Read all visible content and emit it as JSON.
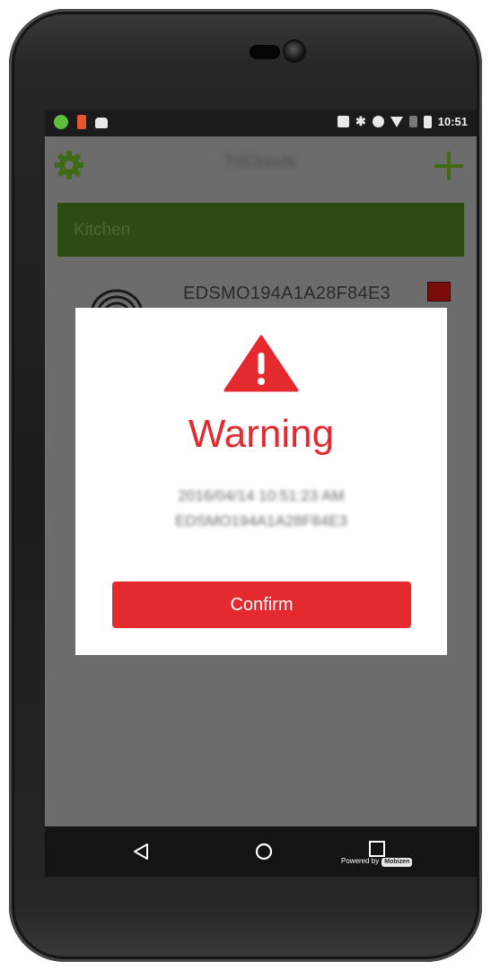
{
  "status_bar": {
    "time": "10:51",
    "icons": [
      "app-notification-icon",
      "app-notification-icon",
      "android-icon",
      "nfc-icon",
      "bluetooth-icon",
      "do-not-disturb-icon",
      "wifi-icon",
      "signal-icon",
      "battery-icon"
    ]
  },
  "app_bar": {
    "title": "TriClouds",
    "settings_icon": "gear-icon",
    "add_icon": "plus-icon"
  },
  "room": {
    "name": "Kitchen"
  },
  "device": {
    "id": "EDSMO194A1A28F84E3",
    "status_color": "#7a0c0c"
  },
  "dialog": {
    "icon": "warning-triangle-icon",
    "title": "Warning",
    "timestamp": "2016/04/14 10:51:23 AM",
    "device_id": "EDSMO194A1A28F84E3",
    "confirm_label": "Confirm"
  },
  "nav_bar": {
    "powered_by": "Powered by",
    "logo": "Mobizen"
  },
  "colors": {
    "accent": "#e52a2f",
    "brand_green": "#2c4c14",
    "icon_green": "#3f6b14"
  }
}
